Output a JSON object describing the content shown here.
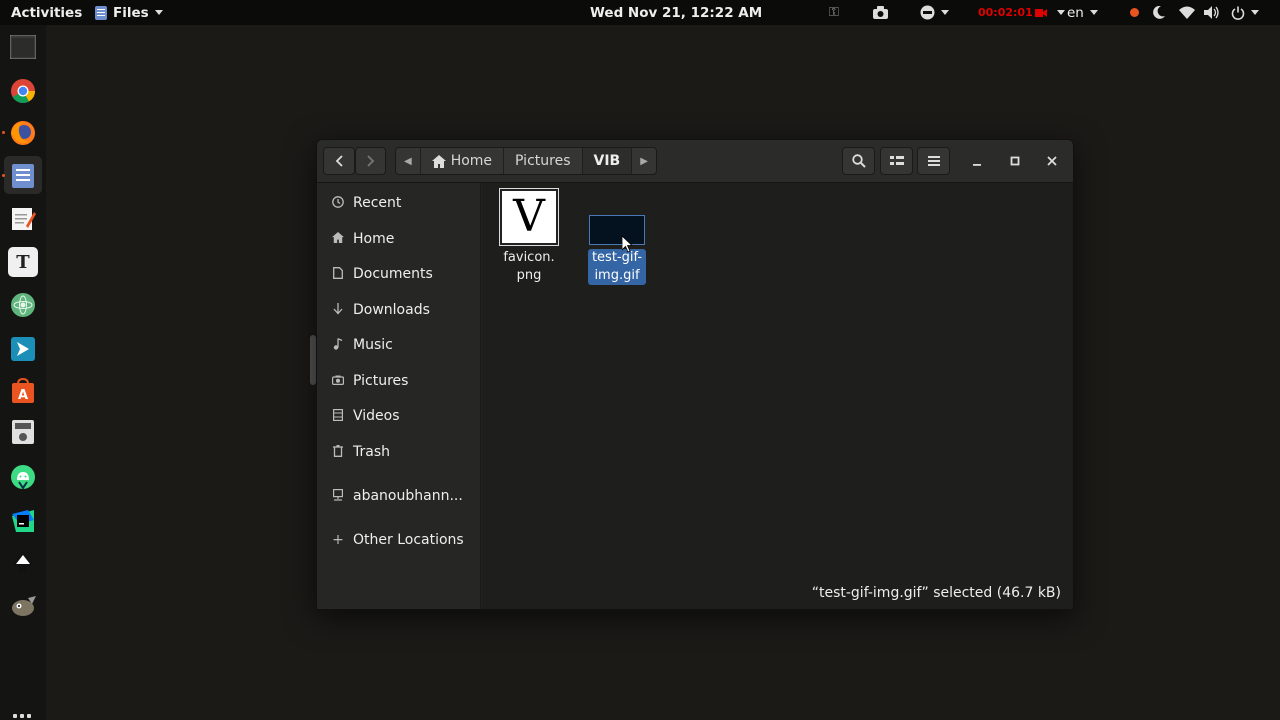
{
  "topbar": {
    "activities": "Activities",
    "app_menu": "Files",
    "clock": "Wed Nov 21, 12:22 AM",
    "recording_time": "00:02:01",
    "language": "en"
  },
  "dock": {
    "items": [
      "terminal",
      "chrome",
      "firefox",
      "files",
      "text-editor",
      "typora",
      "atom",
      "code-editor",
      "ubuntu-software",
      "sound-recorder",
      "android-studio",
      "pycharm",
      "inkscape",
      "gimp"
    ],
    "show_apps": "show-applications"
  },
  "window": {
    "nav": {
      "back": "‹",
      "forward": "›"
    },
    "breadcrumbs": [
      "Home",
      "Pictures",
      "VIB"
    ],
    "sidebar": {
      "items": [
        {
          "label": "Recent",
          "icon": "clock-icon"
        },
        {
          "label": "Home",
          "icon": "home-icon"
        },
        {
          "label": "Documents",
          "icon": "document-icon"
        },
        {
          "label": "Downloads",
          "icon": "download-icon"
        },
        {
          "label": "Music",
          "icon": "music-icon"
        },
        {
          "label": "Pictures",
          "icon": "camera-icon"
        },
        {
          "label": "Videos",
          "icon": "video-icon"
        },
        {
          "label": "Trash",
          "icon": "trash-icon"
        }
      ],
      "drive": "abanoubhann...",
      "other_locations": "Other Locations"
    },
    "files": [
      {
        "name": "favicon.\npng",
        "thumb_letter": "V",
        "selected": false
      },
      {
        "name": "test-gif-\nimg.gif",
        "selected": true
      }
    ],
    "status": "“test-gif-img.gif” selected  (46.7 kB)"
  },
  "colors": {
    "selection": "#3465a4",
    "recording": "#e00000",
    "accent": "#e95420"
  }
}
